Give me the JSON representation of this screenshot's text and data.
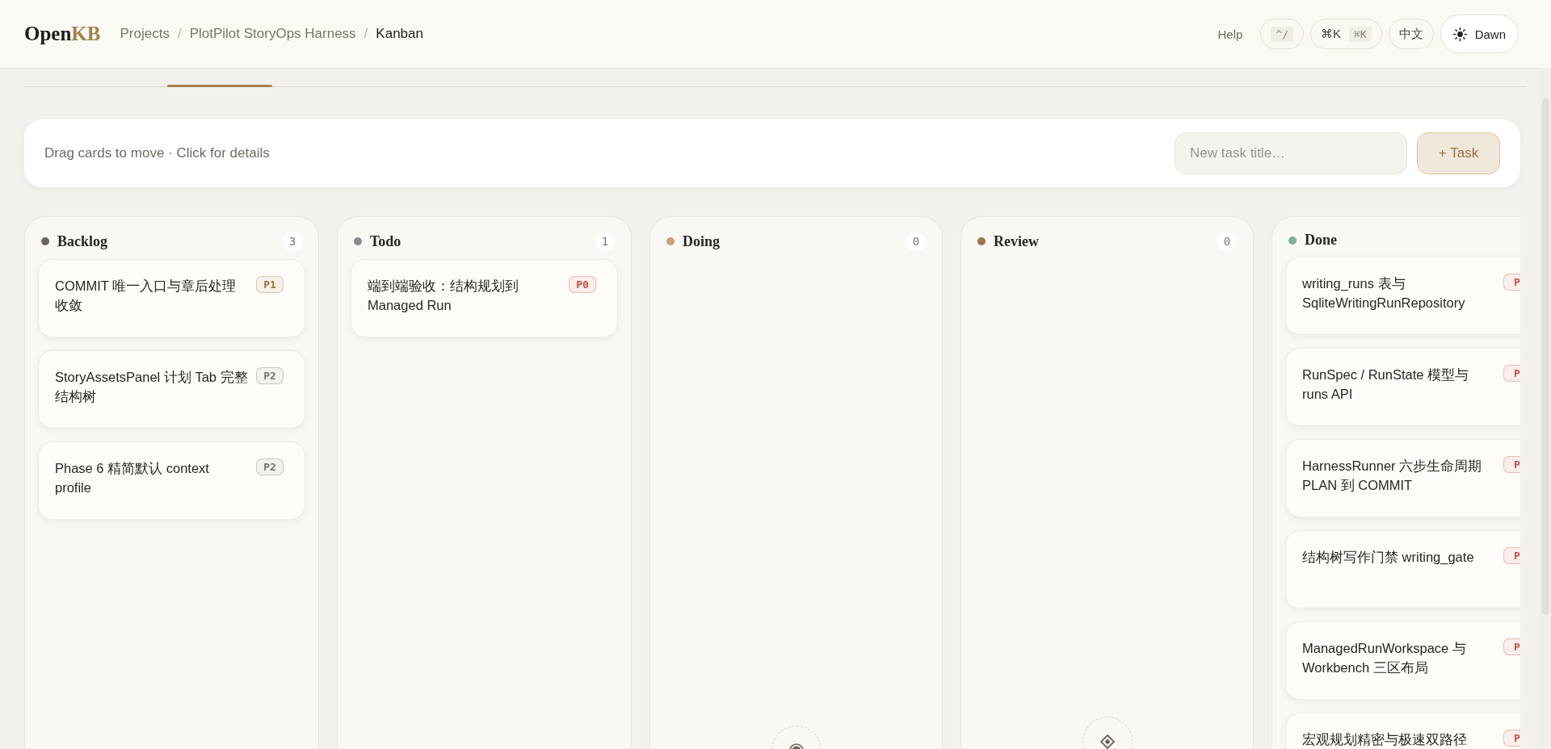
{
  "header": {
    "logo": {
      "text": "Open",
      "accent": "KB"
    },
    "breadcrumbs": [
      {
        "kind": "link",
        "label": "Projects"
      },
      {
        "kind": "separator",
        "label": "/"
      },
      {
        "kind": "link",
        "label": "PlotPilot StoryOps Harness"
      },
      {
        "kind": "separator",
        "label": "/"
      },
      {
        "kind": "current",
        "label": "Kanban"
      }
    ],
    "help": "Help",
    "buttons": [
      {
        "kind": "keys",
        "keys": [
          "^/"
        ]
      },
      {
        "kind": "keys",
        "label": "⌘K",
        "keys": [
          "⌘K"
        ]
      },
      {
        "kind": "plain",
        "label": "中文"
      },
      {
        "kind": "theme",
        "label": "Dawn"
      }
    ]
  },
  "toolbar": {
    "hint": "Drag cards to move · Click for details",
    "placeholder": "New task title…",
    "button": "+ Task"
  },
  "columns": [
    {
      "kind": "tasks",
      "title": "Backlog",
      "color": "#6b645c",
      "count": "3",
      "tasks": [
        {
          "title": "COMMIT 唯一入口与章后处理收敛",
          "priority": "P1",
          "color": "#9a7440"
        },
        {
          "title": "StoryAssetsPanel 计划 Tab 完整结构树",
          "priority": "P2",
          "color": "#77726b"
        },
        {
          "title": "Phase 6 精简默认 context profile",
          "priority": "P2",
          "color": "#77726b"
        }
      ]
    },
    {
      "kind": "tasks",
      "title": "Todo",
      "color": "#8a8c96",
      "count": "1",
      "tasks": [
        {
          "title": "端到端验收：结构规划到 Managed Run",
          "priority": "P0",
          "color": "#c9514a"
        }
      ]
    },
    {
      "kind": "empty-target",
      "title": "Doing",
      "color": "#c9a27a",
      "count": "0"
    },
    {
      "kind": "empty-diamond",
      "title": "Review",
      "color": "#9a7448",
      "count": "0"
    },
    {
      "kind": "tasks",
      "title": "Done",
      "color": "#7fb39a",
      "tasks": [
        {
          "title": "writing_runs 表与 SqliteWritingRunRepository",
          "priority": "P",
          "color": "#c9514a"
        },
        {
          "title": "RunSpec / RunState 模型与 runs API",
          "priority": "P",
          "color": "#c9514a"
        },
        {
          "title": "HarnessRunner 六步生命周期 PLAN 到 COMMIT",
          "priority": "P",
          "color": "#c9514a"
        },
        {
          "title": "结构树写作门禁 writing_gate",
          "priority": "P",
          "color": "#c9514a"
        },
        {
          "title": "ManagedRunWorkspace 与 Workbench 三区布局",
          "priority": "P",
          "color": "#c9514a"
        },
        {
          "title": "宏观规划精密与极速双路径",
          "priority": "P",
          "color": "#c9514a"
        }
      ]
    }
  ]
}
